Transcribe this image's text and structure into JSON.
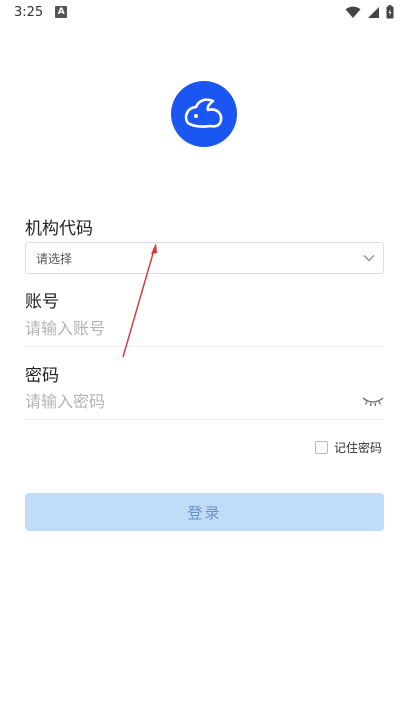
{
  "status_bar": {
    "time": "3:25",
    "notification_icon": "A"
  },
  "logo": {
    "icon": "rabbit-logo-icon",
    "color": "#1a57f2"
  },
  "form": {
    "org_code": {
      "label": "机构代码",
      "placeholder": "请选择"
    },
    "account": {
      "label": "账号",
      "placeholder": "请输入账号"
    },
    "password": {
      "label": "密码",
      "placeholder": "请输入密码"
    },
    "remember_password": "记住密码",
    "login_button": "登录"
  },
  "colors": {
    "brand": "#1a57f2",
    "button_bg": "#c0dcf9",
    "button_text": "#6a8fc9",
    "annotation_arrow": "#d9343a"
  }
}
